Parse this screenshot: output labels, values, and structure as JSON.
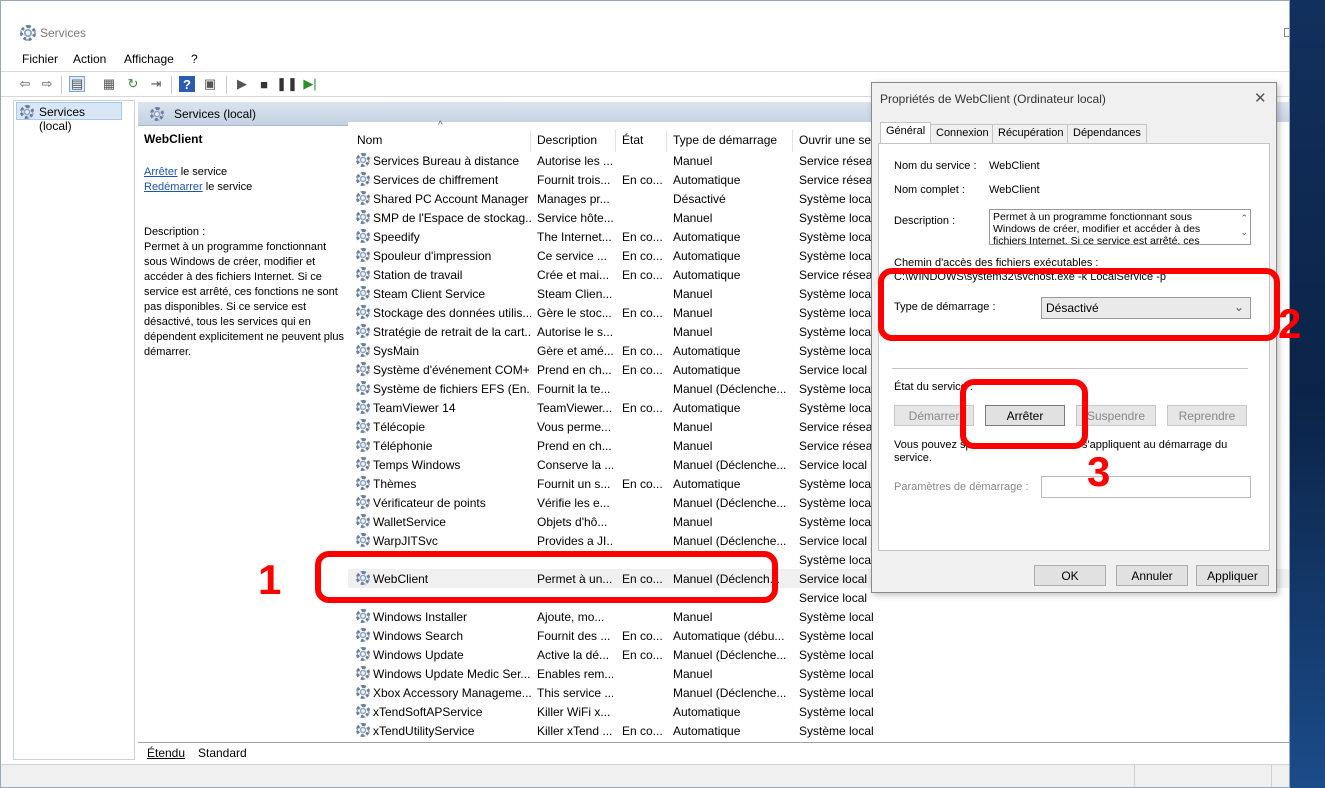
{
  "window": {
    "title": "Services"
  },
  "menu": [
    "Fichier",
    "Action",
    "Affichage",
    "?"
  ],
  "tree": {
    "root": "Services (local)"
  },
  "pane": {
    "header": "Services (local)",
    "selected_service": "WebClient",
    "stop_link": "Arrêter",
    "stop_suffix": "le service",
    "restart_link": "Redémarrer",
    "restart_suffix": "le service",
    "description_label": "Description :",
    "description_text": "Permet à un programme fonctionnant sous Windows de créer, modifier et accéder à des fichiers Internet. Si ce service est arrêté, ces fonctions ne sont pas disponibles. Si ce service est désactivé, tous les services qui en dépendent explicitement ne peuvent plus démarrer."
  },
  "columns": [
    "Nom",
    "Description",
    "État",
    "Type de démarrage",
    "Ouvrir une ses"
  ],
  "services": [
    [
      "Services Bureau à distance",
      "Autorise les ...",
      "",
      "Manuel",
      "Service réseau"
    ],
    [
      "Services de chiffrement",
      "Fournit trois...",
      "En co...",
      "Automatique",
      "Service réseau"
    ],
    [
      "Shared PC Account Manager",
      "Manages pr...",
      "",
      "Désactivé",
      "Système local"
    ],
    [
      "SMP de l'Espace de stockag...",
      "Service hôte...",
      "",
      "Manuel",
      "Système local"
    ],
    [
      "Speedify",
      "The Internet...",
      "En co...",
      "Automatique",
      "Système local"
    ],
    [
      "Spouleur d'impression",
      "Ce service ...",
      "En co...",
      "Automatique",
      "Système local"
    ],
    [
      "Station de travail",
      "Crée et mai...",
      "En co...",
      "Automatique",
      "Service réseau"
    ],
    [
      "Steam Client Service",
      "Steam Clien...",
      "",
      "Manuel",
      "Système local"
    ],
    [
      "Stockage des données utilis...",
      "Gère le stoc...",
      "En co...",
      "Manuel",
      "Système local"
    ],
    [
      "Stratégie de retrait de la cart...",
      "Autorise le s...",
      "",
      "Manuel",
      "Système local"
    ],
    [
      "SysMain",
      "Gère et amé...",
      "En co...",
      "Automatique",
      "Système local"
    ],
    [
      "Système d'événement COM+",
      "Prend en ch...",
      "En co...",
      "Automatique",
      "Service local"
    ],
    [
      "Système de fichiers EFS (En...",
      "Fournit la te...",
      "",
      "Manuel (Déclenche...",
      "Système local"
    ],
    [
      "TeamViewer 14",
      "TeamViewer...",
      "En co...",
      "Automatique",
      "Système local"
    ],
    [
      "Télécopie",
      "Vous perme...",
      "",
      "Manuel",
      "Service réseau"
    ],
    [
      "Téléphonie",
      "Prend en ch...",
      "",
      "Manuel",
      "Service réseau"
    ],
    [
      "Temps Windows",
      "Conserve la ...",
      "",
      "Manuel (Déclenche...",
      "Service local"
    ],
    [
      "Thèmes",
      "Fournit un s...",
      "En co...",
      "Automatique",
      "Système local"
    ],
    [
      "Vérificateur de points",
      "Vérifie les e...",
      "",
      "Manuel (Déclenche...",
      "Système local"
    ],
    [
      "WalletService",
      "Objets d'hô...",
      "",
      "Manuel",
      "Système local"
    ],
    [
      "WarpJITSvc",
      "Provides a JI...",
      "",
      "Manuel (Déclenche...",
      "Service local"
    ],
    [
      "",
      "",
      "",
      "",
      "Système local"
    ],
    [
      "WebClient",
      "Permet à un...",
      "En co...",
      "Manuel (Déclench...",
      "Service local"
    ],
    [
      "",
      "",
      "",
      "",
      "Service local"
    ],
    [
      "Windows Installer",
      "Ajoute, mo...",
      "",
      "Manuel",
      "Système local"
    ],
    [
      "Windows Search",
      "Fournit des ...",
      "En co...",
      "Automatique (débu...",
      "Système local"
    ],
    [
      "Windows Update",
      "Active la dé...",
      "En co...",
      "Manuel (Déclenche...",
      "Système local"
    ],
    [
      "Windows Update Medic Ser...",
      "Enables rem...",
      "",
      "Manuel",
      "Système local"
    ],
    [
      "Xbox Accessory Manageme...",
      "This service ...",
      "",
      "Manuel (Déclenche...",
      "Système local"
    ],
    [
      "xTendSoftAPService",
      "Killer WiFi x...",
      "",
      "Automatique",
      "Système local"
    ],
    [
      "xTendUtilityService",
      "Killer xTend ...",
      "En co...",
      "Automatique",
      "Système local"
    ]
  ],
  "bottom_tabs": [
    "Étendu",
    "Standard"
  ],
  "dialog": {
    "title": "Propriétés de WebClient (Ordinateur local)",
    "tabs": [
      "Général",
      "Connexion",
      "Récupération",
      "Dépendances"
    ],
    "service_name_label": "Nom du service :",
    "service_name": "WebClient",
    "display_name_label": "Nom complet :",
    "display_name": "WebClient",
    "description_label": "Description :",
    "description": "Permet à un programme fonctionnant sous Windows de créer, modifier et accéder à des fichiers Internet. Si ce service est arrêté, ces",
    "path_label": "Chemin d'accès des fichiers exécutables :",
    "path": "C:\\WINDOWS\\system32\\svchost.exe -k LocalService -p",
    "startup_type_label": "Type de démarrage :",
    "startup_type": "Désactivé",
    "status_label": "État du service :",
    "start_btn": "Démarrer",
    "stop_btn": "Arrêter",
    "pause_btn": "Suspendre",
    "resume_btn": "Reprendre",
    "help_text_a": "Vous pouvez sp",
    "help_text_b": "s'appliquent au démarrage du",
    "help_text_c": "service.",
    "params_label": "Paramètres de démarrage :",
    "ok": "OK",
    "cancel": "Annuler",
    "apply": "Appliquer"
  },
  "annotations": [
    "1",
    "2",
    "3"
  ],
  "colors": {
    "annotation": "#ff0000",
    "link": "#1d54b6",
    "pane_header": "#c5d2e3"
  }
}
